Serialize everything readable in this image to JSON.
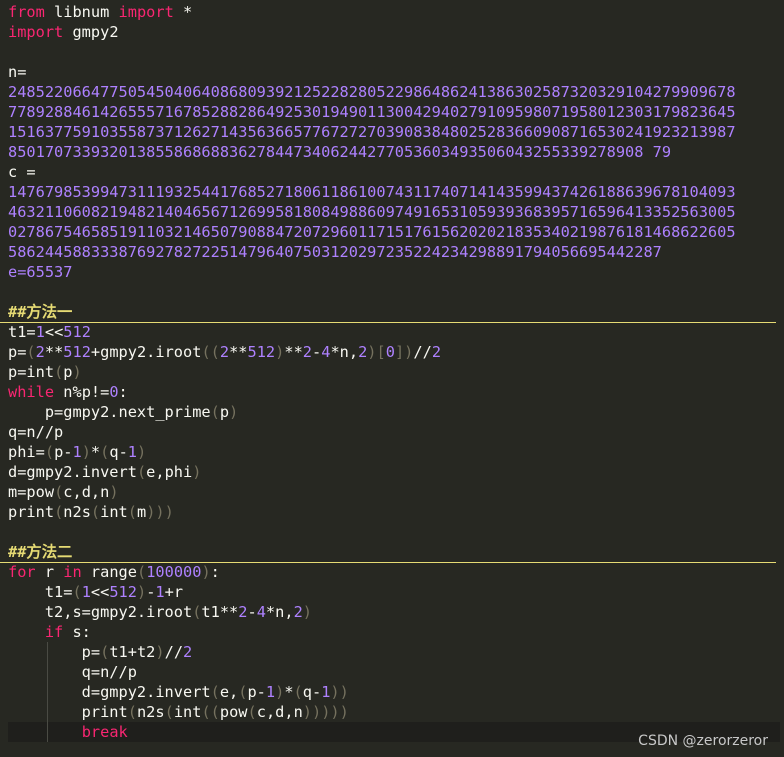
{
  "colors": {
    "background": "#272822",
    "text": "#f8f8f2",
    "keyword": "#f92672",
    "number": "#ae81ff",
    "punct": "#75715e",
    "heading": "#e6db74",
    "current_line": "#1f1f1c"
  },
  "watermark": "CSDN @zerorzeror",
  "lines": [
    {
      "name": "code-line-import-libnum",
      "tokens": [
        [
          "kw",
          "from"
        ],
        [
          "t",
          " libnum "
        ],
        [
          "kw",
          "import"
        ],
        [
          "t",
          " *"
        ]
      ]
    },
    {
      "name": "code-line-import-gmpy2",
      "tokens": [
        [
          "kw",
          "import"
        ],
        [
          "t",
          " gmpy2"
        ]
      ]
    },
    {
      "name": "code-line-blank-1",
      "tokens": []
    },
    {
      "name": "code-line-n-label",
      "tokens": [
        [
          "t",
          "n="
        ]
      ]
    },
    {
      "name": "code-line-n-value-1",
      "tokens": [
        [
          "num",
          "2485220664775054504064086809392125228280522986486241386302587320329104279909678"
        ]
      ]
    },
    {
      "name": "code-line-n-value-2",
      "tokens": [
        [
          "num",
          "7789288461426555716785288286492530194901130042940279109598071958012303179823645"
        ]
      ]
    },
    {
      "name": "code-line-n-value-3",
      "tokens": [
        [
          "num",
          "1516377591035587371262714356366577672727039083848025283660908716530241923213987"
        ]
      ]
    },
    {
      "name": "code-line-n-value-4",
      "tokens": [
        [
          "num",
          "850170733932013855868688362784473406244277053603493506043255339278908 79"
        ]
      ]
    },
    {
      "name": "code-line-c-label",
      "tokens": [
        [
          "t",
          "c ="
        ]
      ]
    },
    {
      "name": "code-line-c-value-1",
      "tokens": [
        [
          "num",
          "1476798539947311193254417685271806118610074311740714143599437426188639678104093"
        ]
      ]
    },
    {
      "name": "code-line-c-value-2",
      "tokens": [
        [
          "num",
          "4632110608219482140465671269958180849886097491653105939368395716596413352563005"
        ]
      ]
    },
    {
      "name": "code-line-c-value-3",
      "tokens": [
        [
          "num",
          "0278675465851911032146507908847207296011715176156202021835340219876181468622605"
        ]
      ]
    },
    {
      "name": "code-line-c-value-4",
      "tokens": [
        [
          "num",
          "58624458833387692782722514796407503120297235224234298891794056695442287"
        ]
      ]
    },
    {
      "name": "code-line-e",
      "tokens": [
        [
          "num",
          "e=65537"
        ]
      ]
    },
    {
      "name": "code-line-blank-2",
      "tokens": []
    },
    {
      "name": "code-line-method-one-heading",
      "heading": true,
      "tokens": [
        [
          "hd",
          "##方法一"
        ]
      ]
    },
    {
      "name": "code-line-t1",
      "tokens": [
        [
          "t",
          "t1="
        ],
        [
          "num",
          "1"
        ],
        [
          "t",
          "<<"
        ],
        [
          "num",
          "512"
        ]
      ]
    },
    {
      "name": "code-line-p-iroot",
      "tokens": [
        [
          "t",
          "p="
        ],
        [
          "p",
          "("
        ],
        [
          "num",
          "2"
        ],
        [
          "t",
          "**"
        ],
        [
          "num",
          "512"
        ],
        [
          "t",
          "+gmpy2.iroot"
        ],
        [
          "p",
          "(("
        ],
        [
          "num",
          "2"
        ],
        [
          "t",
          "**"
        ],
        [
          "num",
          "512"
        ],
        [
          "p",
          ")"
        ],
        [
          "t",
          "**"
        ],
        [
          "num",
          "2"
        ],
        [
          "t",
          "-"
        ],
        [
          "num",
          "4"
        ],
        [
          "t",
          "*n,"
        ],
        [
          "num",
          "2"
        ],
        [
          "p",
          ")"
        ],
        [
          "p",
          "["
        ],
        [
          "num",
          "0"
        ],
        [
          "p",
          "]"
        ],
        [
          "p",
          ")"
        ],
        [
          "t",
          "//"
        ],
        [
          "num",
          "2"
        ]
      ]
    },
    {
      "name": "code-line-p-int",
      "tokens": [
        [
          "t",
          "p=int"
        ],
        [
          "p",
          "("
        ],
        [
          "t",
          "p"
        ],
        [
          "p",
          ")"
        ]
      ]
    },
    {
      "name": "code-line-while",
      "tokens": [
        [
          "kw",
          "while"
        ],
        [
          "t",
          " n%p!="
        ],
        [
          "num",
          "0"
        ],
        [
          "t",
          ":"
        ]
      ]
    },
    {
      "name": "code-line-next-prime",
      "tokens": [
        [
          "t",
          "    p=gmpy2.next_prime"
        ],
        [
          "p",
          "("
        ],
        [
          "t",
          "p"
        ],
        [
          "p",
          ")"
        ]
      ]
    },
    {
      "name": "code-line-q",
      "tokens": [
        [
          "t",
          "q=n//p"
        ]
      ]
    },
    {
      "name": "code-line-phi",
      "tokens": [
        [
          "t",
          "phi="
        ],
        [
          "p",
          "("
        ],
        [
          "t",
          "p-"
        ],
        [
          "num",
          "1"
        ],
        [
          "p",
          ")"
        ],
        [
          "t",
          "*"
        ],
        [
          "p",
          "("
        ],
        [
          "t",
          "q-"
        ],
        [
          "num",
          "1"
        ],
        [
          "p",
          ")"
        ]
      ]
    },
    {
      "name": "code-line-d",
      "tokens": [
        [
          "t",
          "d=gmpy2.invert"
        ],
        [
          "p",
          "("
        ],
        [
          "t",
          "e,phi"
        ],
        [
          "p",
          ")"
        ]
      ]
    },
    {
      "name": "code-line-m",
      "tokens": [
        [
          "t",
          "m=pow"
        ],
        [
          "p",
          "("
        ],
        [
          "t",
          "c,d,n"
        ],
        [
          "p",
          ")"
        ]
      ]
    },
    {
      "name": "code-line-print-1",
      "tokens": [
        [
          "t",
          "print"
        ],
        [
          "p",
          "("
        ],
        [
          "t",
          "n2s"
        ],
        [
          "p",
          "("
        ],
        [
          "t",
          "int"
        ],
        [
          "p",
          "("
        ],
        [
          "t",
          "m"
        ],
        [
          "p",
          ")))"
        ]
      ]
    },
    {
      "name": "code-line-blank-3",
      "tokens": []
    },
    {
      "name": "code-line-method-two-heading",
      "heading": true,
      "tokens": [
        [
          "hd",
          "##方法二"
        ]
      ]
    },
    {
      "name": "code-line-for",
      "tokens": [
        [
          "kw",
          "for"
        ],
        [
          "t",
          " r "
        ],
        [
          "kw",
          "in"
        ],
        [
          "t",
          " range"
        ],
        [
          "p",
          "("
        ],
        [
          "num",
          "100000"
        ],
        [
          "p",
          ")"
        ],
        [
          "t",
          ":"
        ]
      ]
    },
    {
      "name": "code-line-t1-loop",
      "tokens": [
        [
          "t",
          "    t1="
        ],
        [
          "p",
          "("
        ],
        [
          "num",
          "1"
        ],
        [
          "t",
          "<<"
        ],
        [
          "num",
          "512"
        ],
        [
          "p",
          ")"
        ],
        [
          "t",
          "-"
        ],
        [
          "num",
          "1"
        ],
        [
          "t",
          "+r"
        ]
      ]
    },
    {
      "name": "code-line-t2",
      "tokens": [
        [
          "t",
          "    t2,s=gmpy2.iroot"
        ],
        [
          "p",
          "("
        ],
        [
          "t",
          "t1**"
        ],
        [
          "num",
          "2"
        ],
        [
          "t",
          "-"
        ],
        [
          "num",
          "4"
        ],
        [
          "t",
          "*n,"
        ],
        [
          "num",
          "2"
        ],
        [
          "p",
          ")"
        ]
      ]
    },
    {
      "name": "code-line-if",
      "tokens": [
        [
          "t",
          "    "
        ],
        [
          "kw",
          "if"
        ],
        [
          "t",
          " s:"
        ]
      ]
    },
    {
      "name": "code-line-p-loop",
      "tokens": [
        [
          "t",
          "        p="
        ],
        [
          "p",
          "("
        ],
        [
          "t",
          "t1+t2"
        ],
        [
          "p",
          ")"
        ],
        [
          "t",
          "//"
        ],
        [
          "num",
          "2"
        ]
      ]
    },
    {
      "name": "code-line-q-loop",
      "tokens": [
        [
          "t",
          "        q=n//p"
        ]
      ]
    },
    {
      "name": "code-line-d-loop",
      "tokens": [
        [
          "t",
          "        d=gmpy2.invert"
        ],
        [
          "p",
          "("
        ],
        [
          "t",
          "e,"
        ],
        [
          "p",
          "("
        ],
        [
          "t",
          "p-"
        ],
        [
          "num",
          "1"
        ],
        [
          "p",
          ")"
        ],
        [
          "t",
          "*"
        ],
        [
          "p",
          "("
        ],
        [
          "t",
          "q-"
        ],
        [
          "num",
          "1"
        ],
        [
          "p",
          "))"
        ]
      ]
    },
    {
      "name": "code-line-print-2",
      "tokens": [
        [
          "t",
          "        print"
        ],
        [
          "p",
          "("
        ],
        [
          "t",
          "n2s"
        ],
        [
          "p",
          "("
        ],
        [
          "t",
          "int"
        ],
        [
          "p",
          "(("
        ],
        [
          "t",
          "pow"
        ],
        [
          "p",
          "("
        ],
        [
          "t",
          "c,d,n"
        ],
        [
          "p",
          ")))))"
        ]
      ]
    },
    {
      "name": "code-line-break",
      "current": true,
      "tokens": [
        [
          "t",
          "        "
        ],
        [
          "kw",
          "break"
        ]
      ]
    }
  ]
}
